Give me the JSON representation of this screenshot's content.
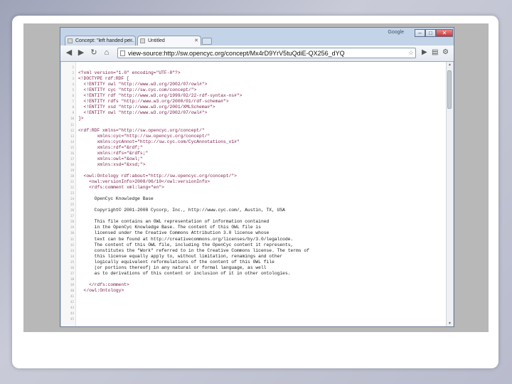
{
  "browser": {
    "brand": "Google",
    "window_buttons": [
      "–",
      "□",
      "✕"
    ],
    "tabs": [
      {
        "title": "Concept: \"left handed pe...",
        "close": "✕"
      },
      {
        "title": "Untitled",
        "close": "✕"
      }
    ],
    "url": "view-source:http://sw.opencyc.org/concept/Mx4rD9YrV5tuQdiE-QX256_dYQ",
    "icons": [
      "back-arrow-icon",
      "forward-arrow-icon",
      "reload-icon",
      "home-icon",
      "star-icon",
      "page-icon",
      "wrench-icon"
    ]
  },
  "source_lines": [
    {
      "n": "1",
      "text": ""
    },
    {
      "n": "2",
      "text": "<?xml version=\"1.0\" encoding=\"UTF-8\"?>",
      "indent": 0,
      "kind": "tag"
    },
    {
      "n": "3",
      "text": "<!DOCTYPE rdf:RDF [",
      "indent": 0,
      "kind": "tag"
    },
    {
      "n": "4",
      "text": "  <!ENTITY owl \"http://www.w3.org/2002/07/owl#\">",
      "indent": 1,
      "kind": "tag"
    },
    {
      "n": "5",
      "text": "  <!ENTITY cyc \"http://sw.cyc.com/concept/\">",
      "indent": 1,
      "kind": "tag"
    },
    {
      "n": "6",
      "text": "  <!ENTITY rdf \"http://www.w3.org/1999/02/22-rdf-syntax-ns#\">",
      "indent": 1,
      "kind": "tag"
    },
    {
      "n": "7",
      "text": "  <!ENTITY rdfs \"http://www.w3.org/2000/01/rdf-schema#\">",
      "indent": 1,
      "kind": "tag"
    },
    {
      "n": "8",
      "text": "  <!ENTITY xsd \"http://www.w3.org/2001/XMLSchema#\">",
      "indent": 1,
      "kind": "tag"
    },
    {
      "n": "9",
      "text": "  <!ENTITY owl \"http://www.w3.org/2002/07/owl#\">",
      "indent": 1,
      "kind": "tag"
    },
    {
      "n": "10",
      "text": "]>",
      "indent": 0,
      "kind": "tag"
    },
    {
      "n": "11",
      "text": ""
    },
    {
      "n": "12",
      "text": "<rdf:RDF xmlns=\"http://sw.opencyc.org/concept/\"",
      "indent": 0,
      "kind": "tag"
    },
    {
      "n": "13",
      "text": "       xmlns:cyc=\"http://sw.opencyc.org/concept/\"",
      "indent": 3,
      "kind": "tag"
    },
    {
      "n": "14",
      "text": "       xmlns:cycAnnot=\"http://sw.cyc.com/CycAnnotations_v1#\"",
      "indent": 3,
      "kind": "tag"
    },
    {
      "n": "15",
      "text": "       xmlns:rdf=\"&rdf;\"",
      "indent": 3,
      "kind": "tag"
    },
    {
      "n": "16",
      "text": "       xmlns:rdfs=\"&rdfs;\"",
      "indent": 3,
      "kind": "tag"
    },
    {
      "n": "17",
      "text": "       xmlns:owl=\"&owl;\"",
      "indent": 3,
      "kind": "tag"
    },
    {
      "n": "18",
      "text": "       xmlns:xsd=\"&xsd;\">",
      "indent": 3,
      "kind": "tag"
    },
    {
      "n": "19",
      "text": ""
    },
    {
      "n": "20",
      "text": "  <owl:Ontology rdf:about=\"http://sw.opencyc.org/concept/\">",
      "indent": 1,
      "kind": "tag"
    },
    {
      "n": "21",
      "text": "    <owl:versionInfo>2008/06/10</owl:versionInfo>",
      "indent": 2,
      "kind": "tag"
    },
    {
      "n": "22",
      "text": "    <rdfs:comment xml:lang=\"en\">",
      "indent": 2,
      "kind": "tag"
    },
    {
      "n": "23",
      "text": ""
    },
    {
      "n": "24",
      "text": "      OpenCyc Knowledge Base",
      "indent": 2,
      "kind": "text"
    },
    {
      "n": "25",
      "text": ""
    },
    {
      "n": "26",
      "text": "      Copyright© 2001-2008 Cycorp, Inc., http://www.cyc.com/, Austin, TX, USA",
      "indent": 2,
      "kind": "text"
    },
    {
      "n": "27",
      "text": ""
    },
    {
      "n": "28",
      "text": "      This file contains an OWL representation of information contained",
      "indent": 2,
      "kind": "text"
    },
    {
      "n": "29",
      "text": "      in the OpenCyc Knowledge Base. The content of this OWL file is",
      "indent": 2,
      "kind": "text"
    },
    {
      "n": "30",
      "text": "      licensed under the Creative Commons Attribution 3.0 license whose",
      "indent": 2,
      "kind": "text"
    },
    {
      "n": "31",
      "text": "      text can be found at http://creativecommons.org/licenses/by/3.0/legalcode.",
      "indent": 2,
      "kind": "text"
    },
    {
      "n": "32",
      "text": "      The content of this OWL file, including the OpenCyc content it represents,",
      "indent": 2,
      "kind": "text"
    },
    {
      "n": "33",
      "text": "      constitutes the \"Work\" referred to in the Creative Commons license. The terms of",
      "indent": 2,
      "kind": "text"
    },
    {
      "n": "34",
      "text": "      this license equally apply to, without limitation, renamings and other",
      "indent": 2,
      "kind": "text"
    },
    {
      "n": "35",
      "text": "      logically equivalent reformulations of the content of this OWL file",
      "indent": 2,
      "kind": "text"
    },
    {
      "n": "36",
      "text": "      (or portions thereof) in any natural or formal language, as well",
      "indent": 2,
      "kind": "text"
    },
    {
      "n": "37",
      "text": "      as to derivations of this content or inclusion of it in other ontologies.",
      "indent": 2,
      "kind": "text"
    },
    {
      "n": "38",
      "text": ""
    },
    {
      "n": "39",
      "text": "    </rdfs:comment>",
      "indent": 2,
      "kind": "tag"
    },
    {
      "n": "40",
      "text": "  </owl:Ontology>",
      "indent": 1,
      "kind": "tag"
    },
    {
      "n": "41",
      "text": ""
    },
    {
      "n": "42",
      "text": ""
    },
    {
      "n": "43",
      "text": ""
    },
    {
      "n": "44",
      "text": ""
    },
    {
      "n": "45",
      "text": ""
    }
  ]
}
